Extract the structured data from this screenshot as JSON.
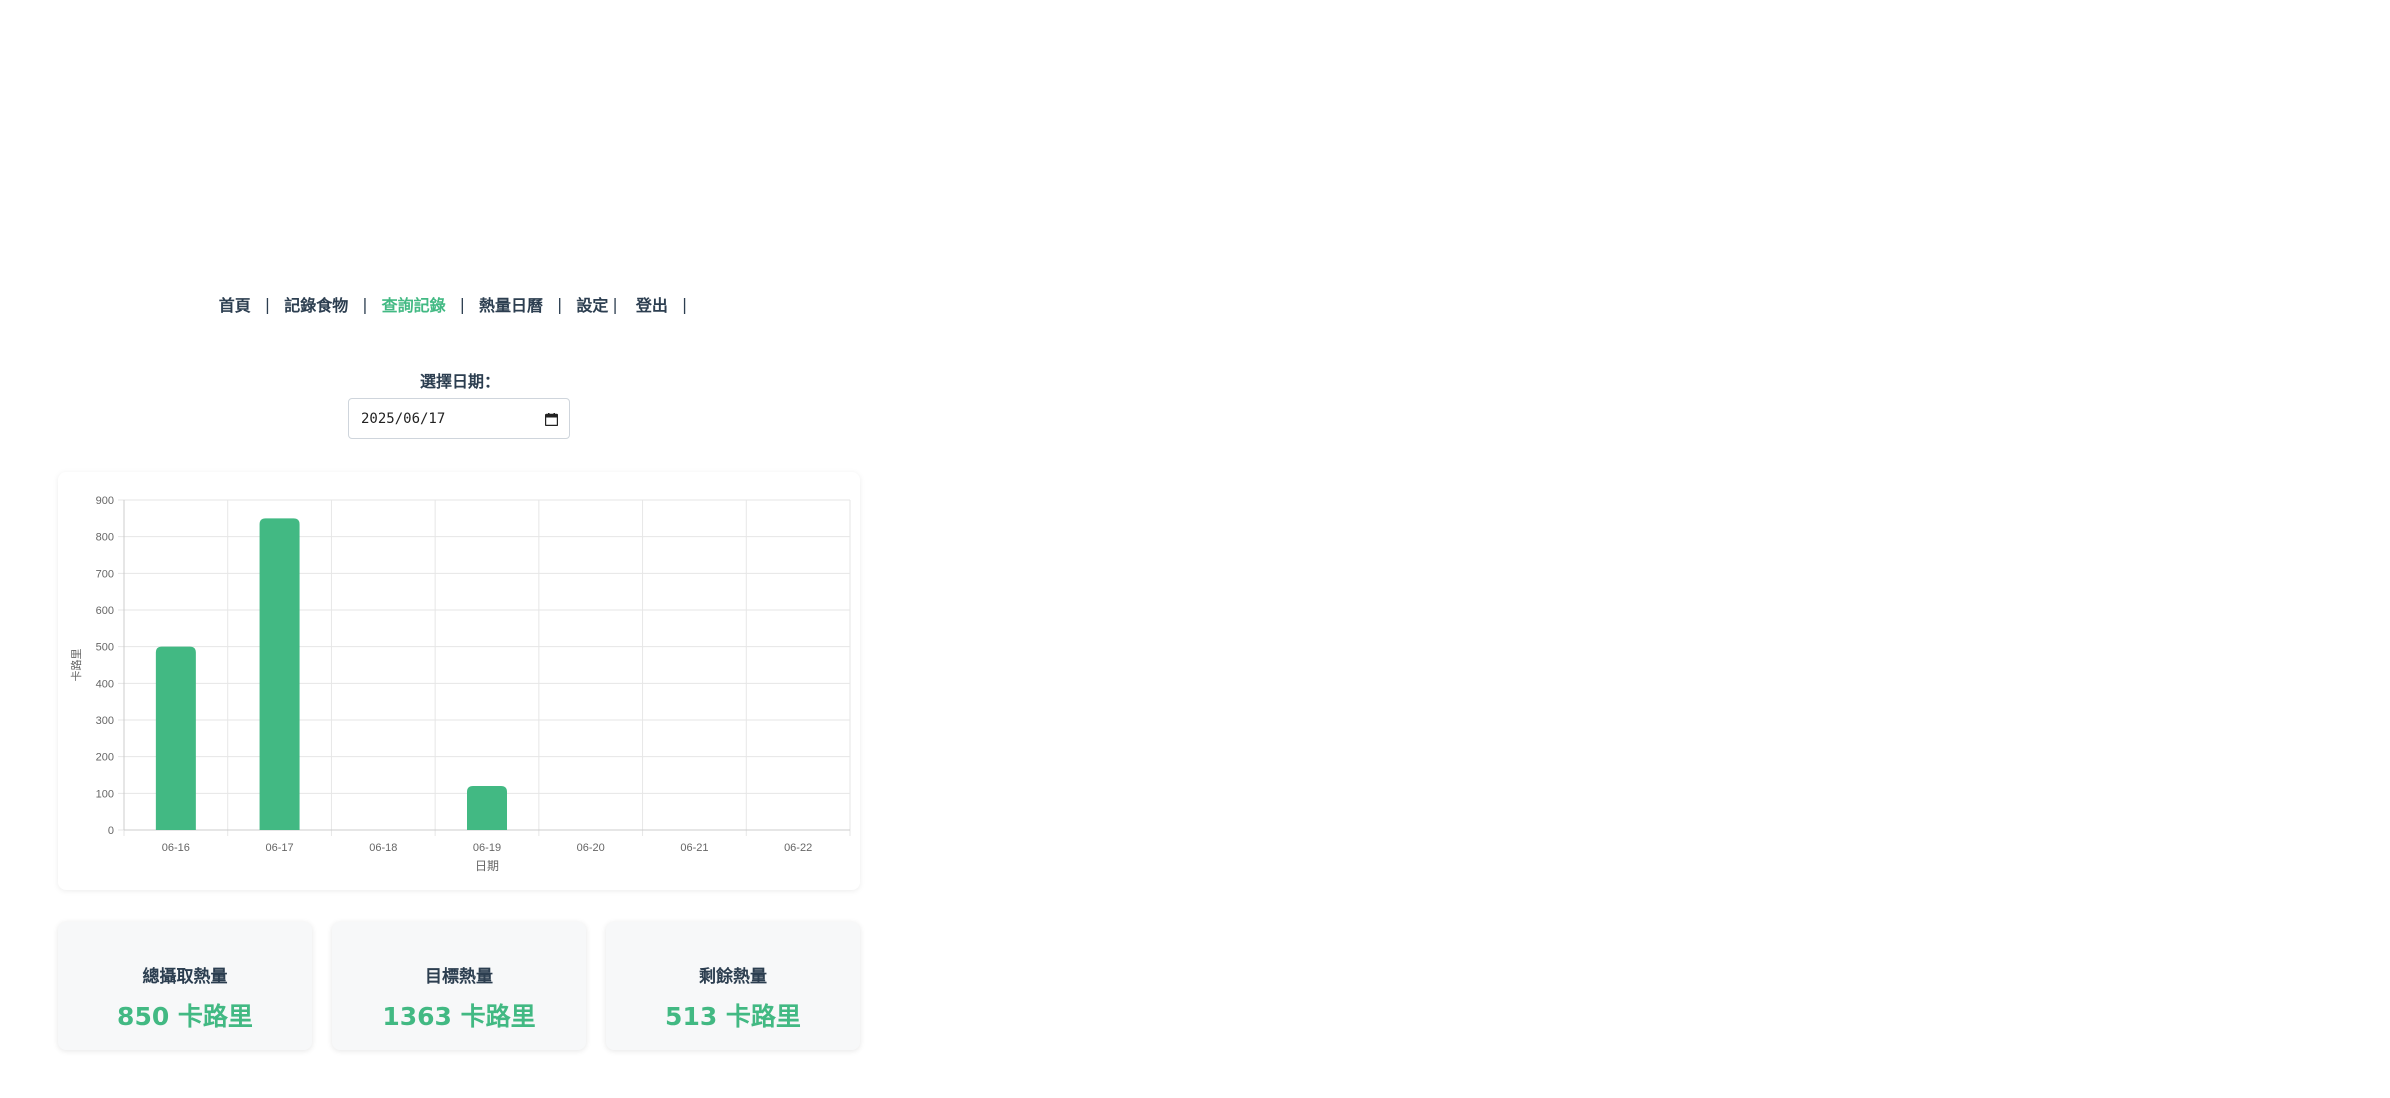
{
  "nav": {
    "items": [
      {
        "label": "首頁",
        "active": false
      },
      {
        "label": "記錄食物",
        "active": false
      },
      {
        "label": "查詢記錄",
        "active": true
      },
      {
        "label": "熱量日曆",
        "active": false
      },
      {
        "label": "設定",
        "active": false
      },
      {
        "label": "登出",
        "active": false
      }
    ],
    "separator": "|"
  },
  "date_picker": {
    "label": "選擇日期：",
    "value": "2025/06/17"
  },
  "chart_data": {
    "type": "bar",
    "categories": [
      "06-16",
      "06-17",
      "06-18",
      "06-19",
      "06-20",
      "06-21",
      "06-22"
    ],
    "values": [
      500,
      850,
      0,
      120,
      0,
      0,
      0
    ],
    "ylim": [
      0,
      900
    ],
    "yticks": [
      0,
      100,
      200,
      300,
      400,
      500,
      600,
      700,
      800,
      900
    ],
    "xlabel": "日期",
    "ylabel": "卡路里",
    "grid": true,
    "bar_color": "#42b983"
  },
  "summary": {
    "total": {
      "title": "總攝取熱量",
      "value": "850 卡路里"
    },
    "target": {
      "title": "目標熱量",
      "value": "1363 卡路里"
    },
    "remaining": {
      "title": "剩餘熱量",
      "value": "513 卡路里"
    }
  },
  "colors": {
    "accent": "#42b983",
    "text": "#2c3e50"
  }
}
